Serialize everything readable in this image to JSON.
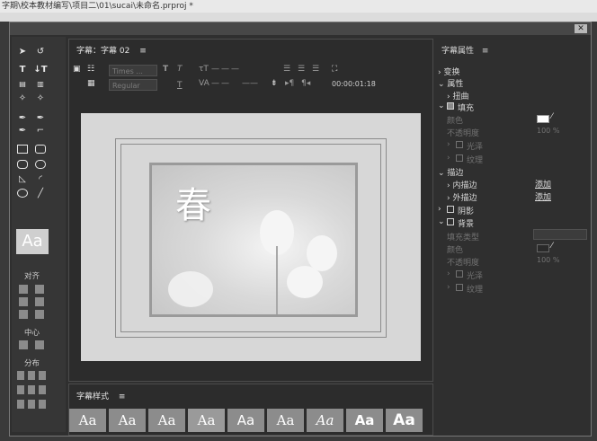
{
  "app": {
    "path_title": "字期\\校本教材编写\\项目二\\01\\sucai\\未命名.prproj *"
  },
  "titler": {
    "panel_title": "字幕：字幕 02",
    "menu_icon": "hamburger-icon",
    "font_family": "Times ...",
    "font_style": "Regular",
    "timecode": "00:00:01:18",
    "caption_text": "春",
    "tools_sections": {
      "align": "对齐",
      "center": "中心",
      "distribute": "分布"
    },
    "aa_preview": "Aa"
  },
  "styles_panel": {
    "title": "字幕样式",
    "swatches": [
      "Aa",
      "Aa",
      "Aa",
      "Aa",
      "Aa",
      "Aa",
      "Aa",
      "Aa",
      "Aa"
    ]
  },
  "properties": {
    "title": "字幕属性",
    "transform": "变换",
    "attributes": "属性",
    "distort": "扭曲",
    "fill": "填充",
    "color": "颜色",
    "opacity": "不透明度",
    "opacity_value": "100 %",
    "sheen": "光泽",
    "texture": "纹理",
    "stroke": "描边",
    "inner_stroke": "内描边",
    "outer_stroke": "外描边",
    "add": "添加",
    "shadow": "阴影",
    "background": "背景",
    "fill_type": "填充类型",
    "bg_color": "颜色",
    "bg_opacity": "不透明度",
    "bg_opacity_value": "100 %",
    "bg_sheen": "光泽",
    "bg_texture": "纹理",
    "colors": {
      "fill": "#ffffff",
      "bg": "#2a2a2a"
    }
  }
}
